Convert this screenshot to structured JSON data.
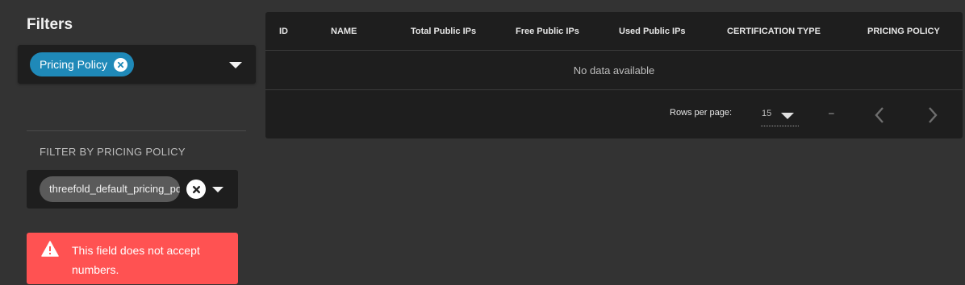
{
  "sidebar": {
    "title": "Filters",
    "filter_select": {
      "chip_label": "Pricing Policy"
    },
    "section_label": "FILTER BY PRICING POLICY",
    "policy_select": {
      "chip_label": "threefold_default_pricing_policy"
    },
    "alert": {
      "message": "This field does not accept numbers."
    }
  },
  "table": {
    "columns": [
      "ID",
      "NAME",
      "Total Public IPs",
      "Free Public IPs",
      "Used Public IPs",
      "CERTIFICATION TYPE",
      "PRICING POLICY"
    ],
    "empty_text": "No data available",
    "footer": {
      "rows_per_page_label": "Rows per page:",
      "rows_per_page_value": "15",
      "page_range": "–"
    }
  },
  "colors": {
    "background": "#333333",
    "surface": "#1e1e1e",
    "chip_blue": "#1f89b8",
    "chip_grey": "#5a5a5a",
    "alert": "#ff5252"
  }
}
